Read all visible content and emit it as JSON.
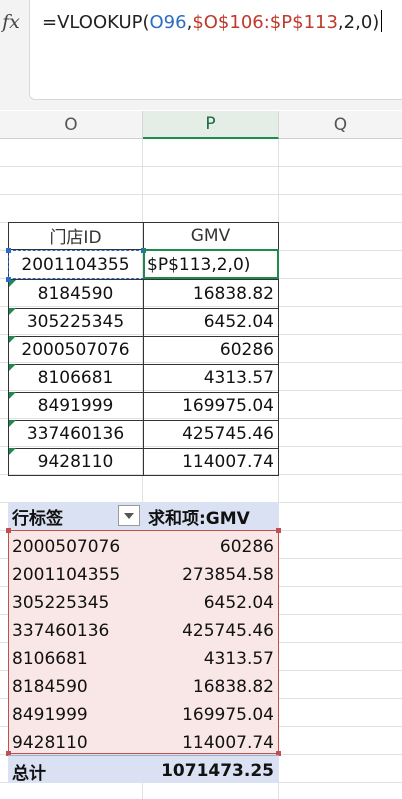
{
  "formula_bar": {
    "fx_label": "fx",
    "parts": [
      "=VLOOKUP(",
      "O96",
      ",",
      "$O$106:$P$113",
      ",2,0)"
    ]
  },
  "columns": [
    "O",
    "P",
    "Q"
  ],
  "source_table": {
    "headers": [
      "门店ID",
      "GMV"
    ],
    "rows": [
      [
        "2001104355",
        "$P$113,2,0)"
      ],
      [
        "8184590",
        "16838.82"
      ],
      [
        "305225345",
        "6452.04"
      ],
      [
        "2000507076",
        "60286"
      ],
      [
        "8106681",
        "4313.57"
      ],
      [
        "8491999",
        "169975.04"
      ],
      [
        "337460136",
        "425745.46"
      ],
      [
        "9428110",
        "114007.74"
      ]
    ]
  },
  "pivot": {
    "row_label_header": "行标签",
    "value_header": "求和项:GMV",
    "rows": [
      [
        "2000507076",
        "60286"
      ],
      [
        "2001104355",
        "273854.58"
      ],
      [
        "305225345",
        "6452.04"
      ],
      [
        "337460136",
        "425745.46"
      ],
      [
        "8106681",
        "4313.57"
      ],
      [
        "8184590",
        "16838.82"
      ],
      [
        "8491999",
        "169975.04"
      ],
      [
        "9428110",
        "114007.74"
      ]
    ],
    "total_label": "总计",
    "total_value": "1071473.25"
  },
  "colors": {
    "accent_green": "#1e8b4d",
    "ref_blue": "#2b6cc4",
    "ref_red": "#c0392b",
    "pivot_header": "#d9e1f2",
    "pivot_body": "#f9e6e6"
  }
}
